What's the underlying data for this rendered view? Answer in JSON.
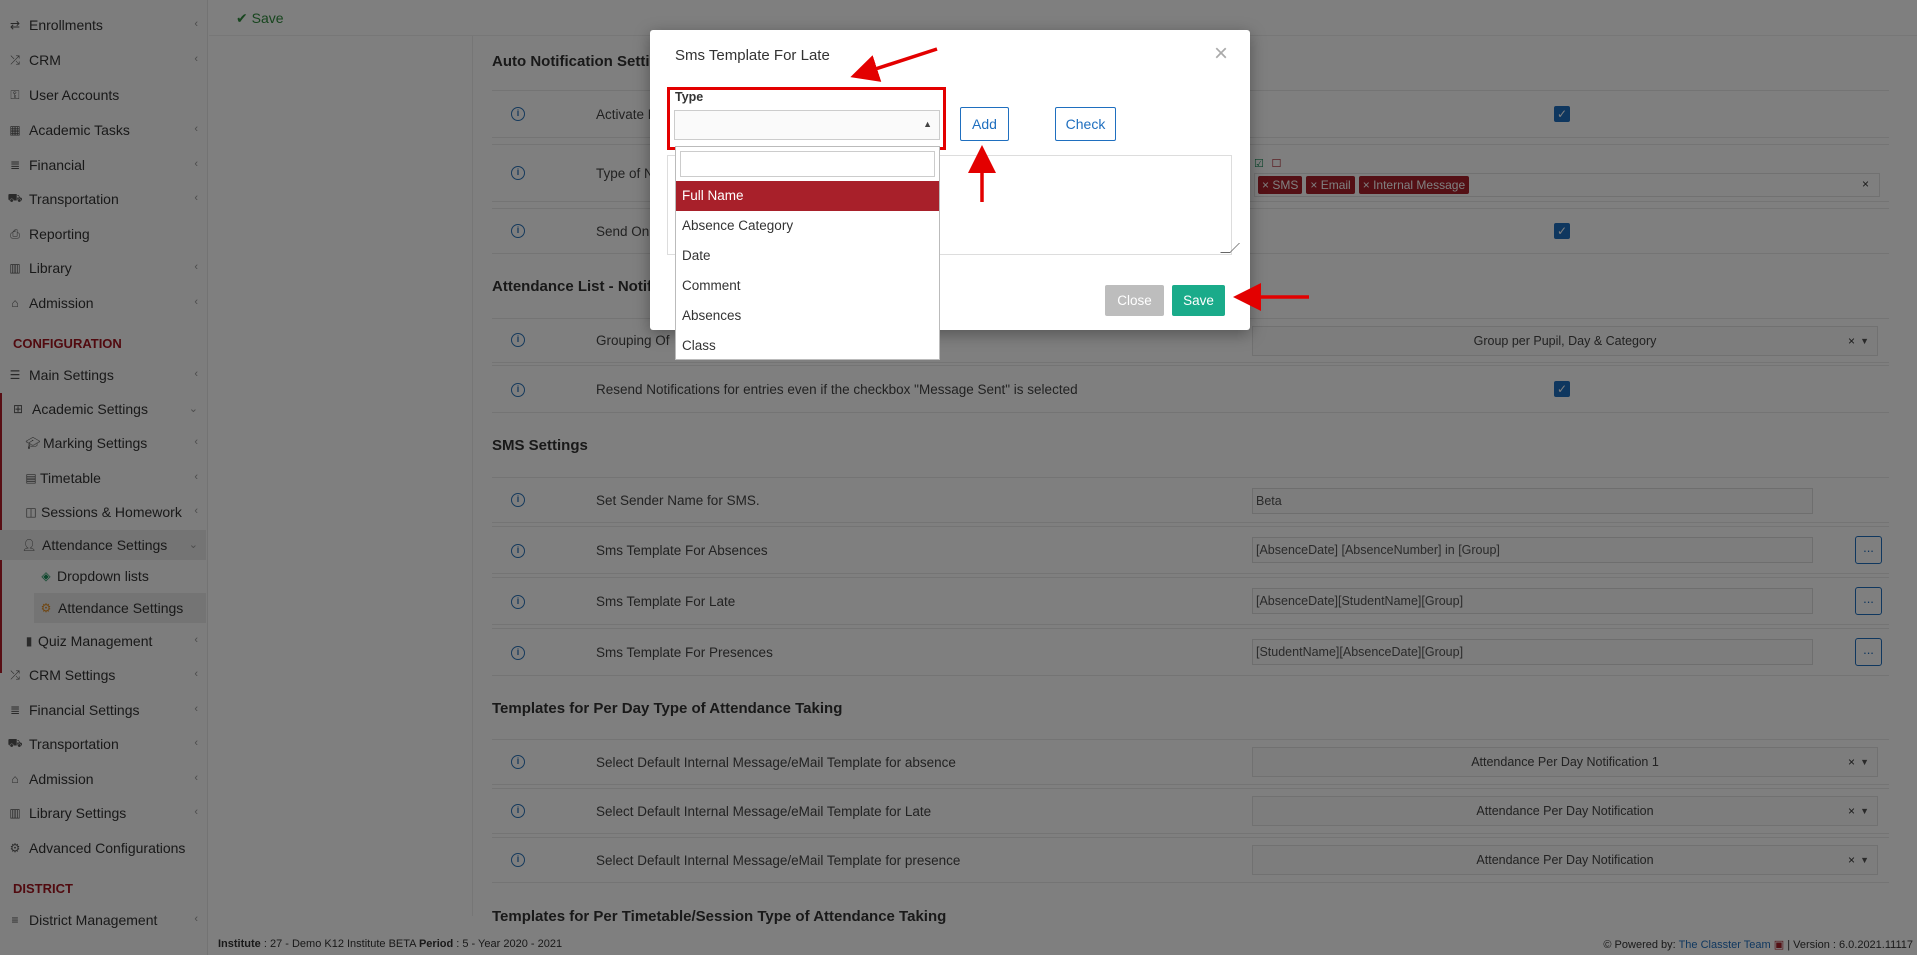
{
  "sidebar": {
    "items": [
      {
        "label": "Enrollments",
        "icon": "arrows-icon"
      },
      {
        "label": "CRM",
        "icon": "crm-icon"
      },
      {
        "label": "User Accounts",
        "icon": "key-icon"
      },
      {
        "label": "Academic Tasks",
        "icon": "grid-icon"
      },
      {
        "label": "Financial",
        "icon": "coins-icon"
      },
      {
        "label": "Transportation",
        "icon": "bus-icon"
      },
      {
        "label": "Reporting",
        "icon": "print-icon"
      },
      {
        "label": "Library",
        "icon": "books-icon"
      },
      {
        "label": "Admission",
        "icon": "bank-icon"
      }
    ],
    "configuration_label": "CONFIGURATION",
    "config_items": [
      {
        "label": "Main Settings",
        "icon": "sliders-icon"
      },
      {
        "label": "Academic Settings",
        "icon": "sitemap-icon"
      },
      {
        "label": "Marking Settings",
        "icon": "graduation-cap-icon"
      },
      {
        "label": "Timetable",
        "icon": "calendar-icon"
      },
      {
        "label": "Sessions & Homework",
        "icon": "presentation-icon"
      },
      {
        "label": "Attendance Settings",
        "icon": "user-clock-icon"
      },
      {
        "label": "Dropdown lists",
        "icon": "layers-icon"
      },
      {
        "label": "Attendance Settings",
        "icon": "gear-icon"
      },
      {
        "label": "Quiz Management",
        "icon": "book-icon"
      },
      {
        "label": "CRM Settings",
        "icon": "crm-icon"
      },
      {
        "label": "Financial Settings",
        "icon": "coins-icon"
      },
      {
        "label": "Transportation",
        "icon": "bus-icon"
      },
      {
        "label": "Admission",
        "icon": "bank-icon"
      },
      {
        "label": "Library Settings",
        "icon": "books-icon"
      },
      {
        "label": "Advanced Configurations",
        "icon": "gears-icon"
      }
    ],
    "district_label": "DISTRICT",
    "district_items": [
      {
        "label": "District Management",
        "icon": "menu-icon"
      }
    ]
  },
  "topbar": {
    "save_label": "Save"
  },
  "sections": {
    "auto_notification": "Auto Notification Settin",
    "attendance_list": "Attendance List - Notifica",
    "sms_settings": "SMS Settings",
    "per_day": "Templates for Per Day Type of Attendance Taking",
    "per_timetable": "Templates for Per Timetable/Session Type of Attendance Taking"
  },
  "rows": {
    "activate": "Activate N",
    "type_of": "Type of N",
    "send_only": "Send Onl",
    "grouping": "Grouping Of",
    "grouping_value": "Group per Pupil, Day & Category",
    "resend": "Resend Notifications for entries even if the checkbox \"Message Sent\" is selected",
    "sender_name": "Set Sender Name for SMS.",
    "sender_value": "Beta",
    "tpl_absences": "Sms Template For Absences",
    "tpl_absences_value": "[AbsenceDate] [AbsenceNumber] in [Group]",
    "tpl_late": "Sms Template For Late",
    "tpl_late_value": "[AbsenceDate][StudentName][Group]",
    "tpl_presences": "Sms Template For Presences",
    "tpl_presences_value": "[StudentName][AbsenceDate][Group]",
    "default_absence": "Select Default Internal Message/eMail Template for absence",
    "default_absence_value": "Attendance Per Day Notification 1",
    "default_late": "Select Default Internal Message/eMail Template for Late",
    "default_late_value": "Attendance Per Day Notification",
    "default_presence": "Select Default Internal Message/eMail Template for presence",
    "default_presence_value": "Attendance Per Day Notification",
    "tags": [
      "SMS",
      "Email",
      "Internal Message"
    ],
    "dots": "..."
  },
  "footer": {
    "institute_label": "Institute",
    "institute_value": ": 27 - Demo K12 Institute BETA",
    "period_label": "Period",
    "period_value": ": 5 - Year 2020 - 2021",
    "powered_by": "Powered by:",
    "team": "The Classter Team",
    "version": "| Version : 6.0.2021.11117"
  },
  "modal": {
    "title": "Sms Template For Late",
    "type_label": "Type",
    "add_label": "Add",
    "check_label": "Check",
    "close_label": "Close",
    "save_label": "Save",
    "dropdown_options": [
      "Full Name",
      "Absence Category",
      "Date",
      "Comment",
      "Absences",
      "Class"
    ],
    "selected_option": "Full Name"
  },
  "colors": {
    "accent_red": "#a8202a",
    "primary_blue": "#1f6fbf",
    "save_green": "#1aab8a",
    "annotation_red": "#e30000"
  }
}
